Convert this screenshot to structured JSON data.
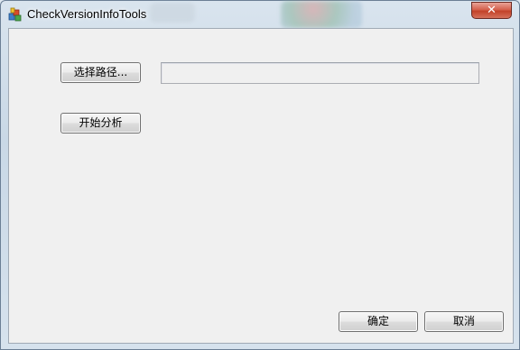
{
  "window": {
    "title": "CheckVersionInfoTools",
    "close_symbol": "✕",
    "icon": "app-icon"
  },
  "main": {
    "select_path_label": "选择路径...",
    "path_value": "",
    "start_analysis_label": "开始分析"
  },
  "footer": {
    "ok_label": "确定",
    "cancel_label": "取消"
  },
  "colors": {
    "client_background": "#f0f0f0",
    "close_button": "#c24229"
  }
}
